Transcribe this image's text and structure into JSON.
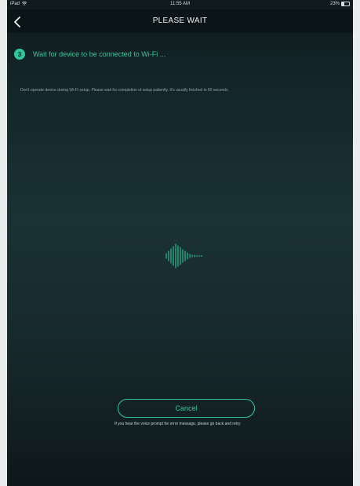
{
  "status_bar": {
    "carrier": "iPad",
    "time": "11:55 AM",
    "battery": "23%"
  },
  "nav": {
    "title": "PLEASE WAIT",
    "back_icon": "chevron-left-icon"
  },
  "step": {
    "number": "3",
    "text": "Wait for device to be connected to Wi-Fi ..."
  },
  "description": "Don't operate device during Wi-Fi setup. Please wait for completion of setup patiently. It's usually finished in 60 seconds.",
  "cancel_label": "Cancel",
  "hint": "If you hear the voice prompt for error message, please go back and retry.",
  "colors": {
    "accent": "#34c89b",
    "background_dark": "#0f1a1d",
    "nav_bar": "#0b1416"
  }
}
